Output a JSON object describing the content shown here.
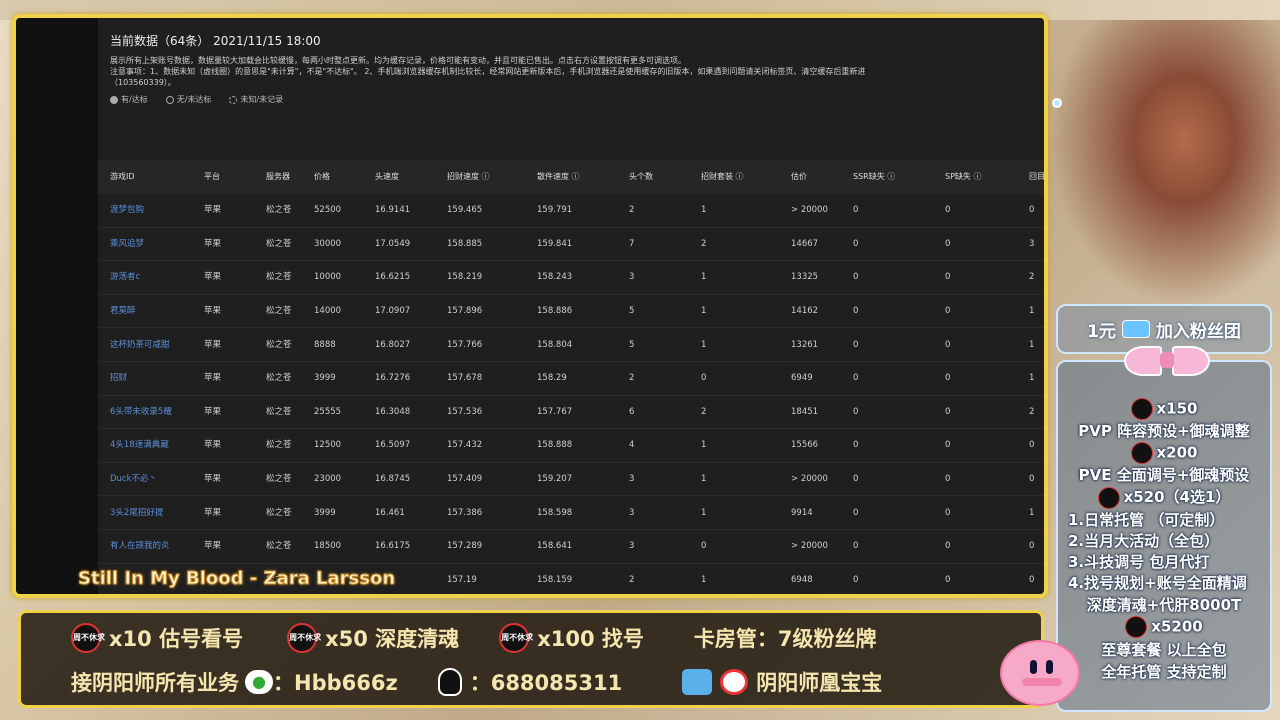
{
  "info": {
    "title": "当前数据（64条） 2021/11/15 18:00",
    "line1": "展示所有上架账号数据，数据量较大加载会比较缓慢，每两小时整点更新。均为缓存记录，价格可能有变动，并且可能已售出。点击右方设置按钮有更多可调选项。",
    "line2": "注意事项：1、数据未知（虚线圈）的意思是\"未计算\"，不是\"不达标\"。 2、手机端浏览器缓存机制比较长，经常网站更新版本后，手机浏览器还是使用缓存的旧版本，如果遇到问题请关闭标签页、清空缓存后重新进",
    "line3": "（103560339）。",
    "legend": [
      "有/达标",
      "无/未达标",
      "未知/未记录"
    ]
  },
  "table": {
    "headers": [
      "游戏ID",
      "平台",
      "服务器",
      "价格",
      "头速度",
      "招财速度 ⓘ",
      "散件速度 ⓘ",
      "头个数",
      "招财套装 ⓘ",
      "估价",
      "SSR缺失 ⓘ",
      "SP缺失 ⓘ",
      "回目"
    ],
    "rows": [
      [
        "渡梦包购",
        "苹果",
        "松之苍",
        "52500",
        "16.9141",
        "159.465",
        "159.791",
        "2",
        "1",
        "> 20000",
        "0",
        "0",
        "0"
      ],
      [
        "乘风追梦",
        "苹果",
        "松之苍",
        "30000",
        "17.0549",
        "158.885",
        "159.841",
        "7",
        "2",
        "14667",
        "0",
        "0",
        "3"
      ],
      [
        "游荡者c",
        "苹果",
        "松之苍",
        "10000",
        "16.6215",
        "158.219",
        "158.243",
        "3",
        "1",
        "13325",
        "0",
        "0",
        "2"
      ],
      [
        "君莫醉",
        "苹果",
        "松之苍",
        "14000",
        "17.0907",
        "157.896",
        "158.886",
        "5",
        "1",
        "14162",
        "0",
        "0",
        "1"
      ],
      [
        "这杯奶茶可咸甜",
        "苹果",
        "松之苍",
        "8888",
        "16.8027",
        "157.766",
        "158.804",
        "5",
        "1",
        "13261",
        "0",
        "0",
        "1"
      ],
      [
        "招财",
        "苹果",
        "松之苍",
        "3999",
        "16.7276",
        "157.678",
        "158.29",
        "2",
        "0",
        "6949",
        "0",
        "0",
        "1"
      ],
      [
        "6头带未收录5耀",
        "苹果",
        "松之苍",
        "25555",
        "16.3048",
        "157.536",
        "157.767",
        "6",
        "2",
        "18451",
        "0",
        "0",
        "2"
      ],
      [
        "4头18速满典藏",
        "苹果",
        "松之苍",
        "12500",
        "16.5097",
        "157.432",
        "158.888",
        "4",
        "1",
        "15566",
        "0",
        "0",
        "0"
      ],
      [
        "Duck不必丶",
        "苹果",
        "松之苍",
        "23000",
        "16.8745",
        "157.409",
        "159.207",
        "3",
        "1",
        "> 20000",
        "0",
        "0",
        "0"
      ],
      [
        "3头2尾招好提",
        "苹果",
        "松之苍",
        "3999",
        "16.461",
        "157.386",
        "158.598",
        "3",
        "1",
        "9914",
        "0",
        "0",
        "1"
      ],
      [
        "有人在觊我的炎",
        "苹果",
        "松之苍",
        "18500",
        "16.6175",
        "157.289",
        "158.641",
        "3",
        "0",
        "> 20000",
        "0",
        "0",
        "0"
      ],
      [
        "",
        "",
        "松之",
        "",
        "",
        "157.19",
        "158.159",
        "2",
        "1",
        "6948",
        "0",
        "0",
        "0"
      ]
    ]
  },
  "song": "Still In My Blood - Zara Larsson",
  "bottom": {
    "seal_text": "周不休求",
    "r1a": "x10 估号看号",
    "r1b": "x50 深度清魂",
    "r1c": "x100 找号",
    "r1d": "卡房管：7级粉丝牌",
    "r2a": "接阴阳师所有业务",
    "r2b": "：Hbb666z",
    "r2c": "：688085311",
    "r2d": "阴阳师凰宝宝"
  },
  "right": {
    "fan": "1元",
    "fan_join": "加入粉丝团",
    "lines": [
      "x150",
      "PVP 阵容预设+御魂调整",
      "x200",
      "PVE 全面调号+御魂预设",
      "x520（4选1）",
      "1.日常托管 （可定制）",
      "2.当月大活动（全包）",
      "3.斗技调号 包月代打",
      "4.找号规划+账号全面精调",
      "深度清魂+代肝8000T",
      "x5200",
      "至尊套餐 以上全包",
      "全年托管 支持定制"
    ]
  },
  "colors": {
    "frame": "#f0d24a",
    "link": "#5b8fd9",
    "panel": "#1f1f1f"
  }
}
